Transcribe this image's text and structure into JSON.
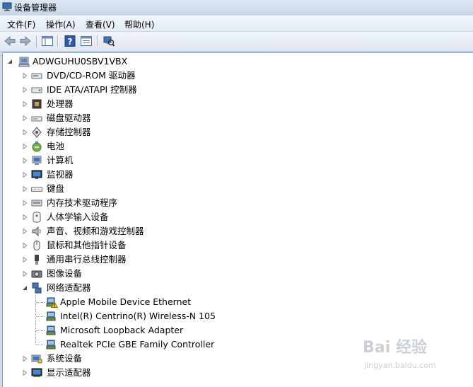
{
  "window": {
    "title": "设备管理器"
  },
  "menu": [
    "文件(F)",
    "操作(A)",
    "查看(V)",
    "帮助(H)"
  ],
  "toolbar": {
    "buttons": [
      {
        "name": "back-button",
        "icon": "arrow-left-icon"
      },
      {
        "name": "forward-button",
        "icon": "arrow-right-icon"
      },
      {
        "name": "show-hide-console-tree-button",
        "icon": "console-tree-icon"
      },
      {
        "name": "help-button",
        "icon": "help-icon"
      },
      {
        "name": "properties-button",
        "icon": "properties-icon"
      },
      {
        "name": "scan-hardware-button",
        "icon": "scan-hardware-icon"
      }
    ]
  },
  "tree": {
    "root": "ADWGUHU0SBV1VBX",
    "categories": [
      {
        "label": "DVD/CD-ROM 驱动器",
        "icon": "dvd-drive-icon"
      },
      {
        "label": "IDE ATA/ATAPI 控制器",
        "icon": "ide-controller-icon"
      },
      {
        "label": "处理器",
        "icon": "processor-icon"
      },
      {
        "label": "磁盘驱动器",
        "icon": "disk-drive-icon"
      },
      {
        "label": "存储控制器",
        "icon": "storage-controller-icon"
      },
      {
        "label": "电池",
        "icon": "battery-icon"
      },
      {
        "label": "计算机",
        "icon": "computer-icon"
      },
      {
        "label": "监视器",
        "icon": "monitor-icon"
      },
      {
        "label": "键盘",
        "icon": "keyboard-icon"
      },
      {
        "label": "内存技术驱动程序",
        "icon": "memory-icon"
      },
      {
        "label": "人体学输入设备",
        "icon": "hid-icon"
      },
      {
        "label": "声音、视频和游戏控制器",
        "icon": "sound-icon"
      },
      {
        "label": "鼠标和其他指针设备",
        "icon": "mouse-icon"
      },
      {
        "label": "通用串行总线控制器",
        "icon": "usb-icon"
      },
      {
        "label": "图像设备",
        "icon": "imaging-icon"
      },
      {
        "label": "网络适配器",
        "icon": "network-adapter-icon",
        "expanded": true,
        "children": [
          {
            "label": "Apple Mobile Device Ethernet",
            "warning": true
          },
          {
            "label": "Intel(R) Centrino(R) Wireless-N 105"
          },
          {
            "label": "Microsoft Loopback Adapter"
          },
          {
            "label": "Realtek PCIe GBE Family Controller"
          }
        ]
      },
      {
        "label": "系统设备",
        "icon": "system-device-icon"
      },
      {
        "label": "显示适配器",
        "icon": "display-adapter-icon"
      }
    ]
  },
  "watermark": {
    "logo": "Bai 经验",
    "url": "jingyan.baidu.com"
  }
}
